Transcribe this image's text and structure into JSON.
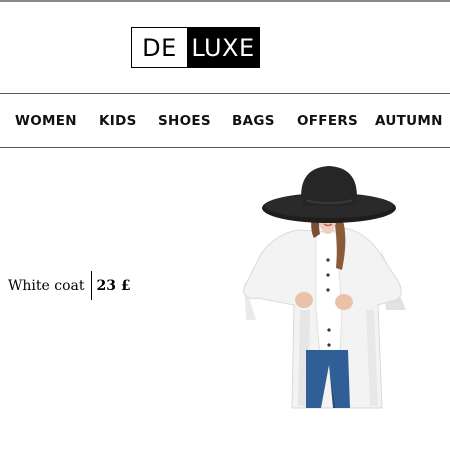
{
  "brand": {
    "logo_left": "DE",
    "logo_right": "LUXE"
  },
  "nav": {
    "items": [
      {
        "label": "WOMEN"
      },
      {
        "label": "KIDS"
      },
      {
        "label": "SHOES"
      },
      {
        "label": "BAGS"
      },
      {
        "label": "OFFERS"
      },
      {
        "label": "AUTUMN"
      }
    ]
  },
  "product": {
    "name": "White coat",
    "price": "23 £"
  },
  "colors": {
    "accent": "#000000",
    "background": "#ffffff",
    "rule": "#555555"
  }
}
